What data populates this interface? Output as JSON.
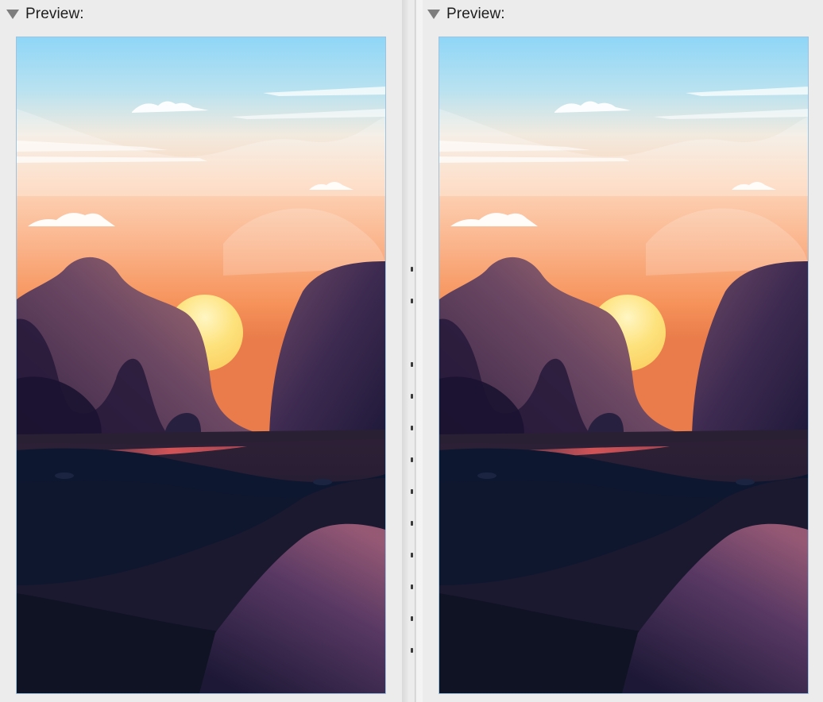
{
  "panels": [
    {
      "id": "left",
      "header_label": "Preview:",
      "disclosure_icon": "triangle-down-icon",
      "image_description_icon": "landscape-sunset-illustration"
    },
    {
      "id": "right",
      "header_label": "Preview:",
      "disclosure_icon": "triangle-down-icon",
      "image_description_icon": "landscape-sunset-illustration"
    }
  ],
  "colors": {
    "sky_top": "#8fd6f7",
    "sky_mid": "#f5e9dd",
    "sky_glow": "#fbb88d",
    "sun": "#fde07a",
    "mountain_light": "#a86f73",
    "mountain_dark": "#2f2142",
    "ground_dark": "#0c1428",
    "ground_mid": "#2b1f35",
    "river_glow": "#e0565a",
    "frame_border": "#9fc3de",
    "background": "#ececec"
  }
}
